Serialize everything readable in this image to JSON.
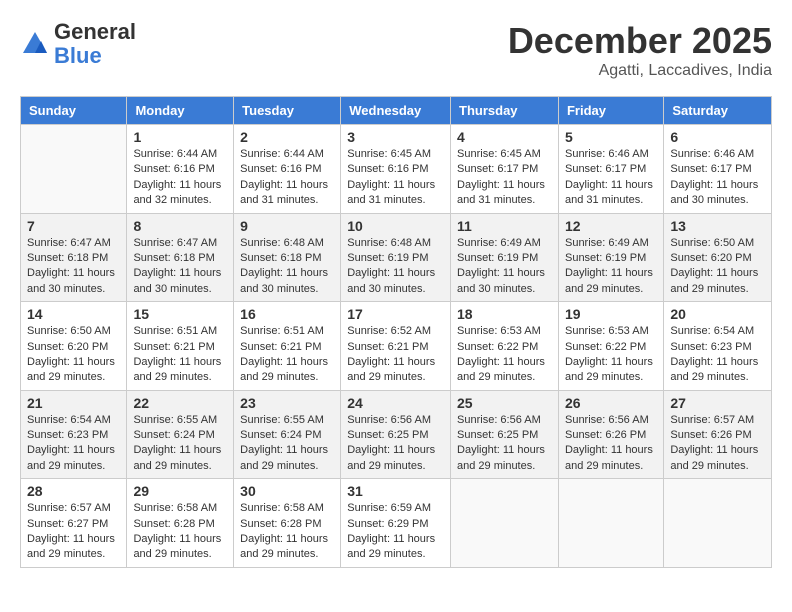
{
  "header": {
    "logo_general": "General",
    "logo_blue": "Blue",
    "title": "December 2025",
    "subtitle": "Agatti, Laccadives, India"
  },
  "calendar": {
    "columns": [
      "Sunday",
      "Monday",
      "Tuesday",
      "Wednesday",
      "Thursday",
      "Friday",
      "Saturday"
    ],
    "weeks": [
      {
        "days": [
          {
            "num": "",
            "info": ""
          },
          {
            "num": "1",
            "info": "Sunrise: 6:44 AM\nSunset: 6:16 PM\nDaylight: 11 hours\nand 32 minutes."
          },
          {
            "num": "2",
            "info": "Sunrise: 6:44 AM\nSunset: 6:16 PM\nDaylight: 11 hours\nand 31 minutes."
          },
          {
            "num": "3",
            "info": "Sunrise: 6:45 AM\nSunset: 6:16 PM\nDaylight: 11 hours\nand 31 minutes."
          },
          {
            "num": "4",
            "info": "Sunrise: 6:45 AM\nSunset: 6:17 PM\nDaylight: 11 hours\nand 31 minutes."
          },
          {
            "num": "5",
            "info": "Sunrise: 6:46 AM\nSunset: 6:17 PM\nDaylight: 11 hours\nand 31 minutes."
          },
          {
            "num": "6",
            "info": "Sunrise: 6:46 AM\nSunset: 6:17 PM\nDaylight: 11 hours\nand 30 minutes."
          }
        ]
      },
      {
        "days": [
          {
            "num": "7",
            "info": "Sunrise: 6:47 AM\nSunset: 6:18 PM\nDaylight: 11 hours\nand 30 minutes."
          },
          {
            "num": "8",
            "info": "Sunrise: 6:47 AM\nSunset: 6:18 PM\nDaylight: 11 hours\nand 30 minutes."
          },
          {
            "num": "9",
            "info": "Sunrise: 6:48 AM\nSunset: 6:18 PM\nDaylight: 11 hours\nand 30 minutes."
          },
          {
            "num": "10",
            "info": "Sunrise: 6:48 AM\nSunset: 6:19 PM\nDaylight: 11 hours\nand 30 minutes."
          },
          {
            "num": "11",
            "info": "Sunrise: 6:49 AM\nSunset: 6:19 PM\nDaylight: 11 hours\nand 30 minutes."
          },
          {
            "num": "12",
            "info": "Sunrise: 6:49 AM\nSunset: 6:19 PM\nDaylight: 11 hours\nand 29 minutes."
          },
          {
            "num": "13",
            "info": "Sunrise: 6:50 AM\nSunset: 6:20 PM\nDaylight: 11 hours\nand 29 minutes."
          }
        ]
      },
      {
        "days": [
          {
            "num": "14",
            "info": "Sunrise: 6:50 AM\nSunset: 6:20 PM\nDaylight: 11 hours\nand 29 minutes."
          },
          {
            "num": "15",
            "info": "Sunrise: 6:51 AM\nSunset: 6:21 PM\nDaylight: 11 hours\nand 29 minutes."
          },
          {
            "num": "16",
            "info": "Sunrise: 6:51 AM\nSunset: 6:21 PM\nDaylight: 11 hours\nand 29 minutes."
          },
          {
            "num": "17",
            "info": "Sunrise: 6:52 AM\nSunset: 6:21 PM\nDaylight: 11 hours\nand 29 minutes."
          },
          {
            "num": "18",
            "info": "Sunrise: 6:53 AM\nSunset: 6:22 PM\nDaylight: 11 hours\nand 29 minutes."
          },
          {
            "num": "19",
            "info": "Sunrise: 6:53 AM\nSunset: 6:22 PM\nDaylight: 11 hours\nand 29 minutes."
          },
          {
            "num": "20",
            "info": "Sunrise: 6:54 AM\nSunset: 6:23 PM\nDaylight: 11 hours\nand 29 minutes."
          }
        ]
      },
      {
        "days": [
          {
            "num": "21",
            "info": "Sunrise: 6:54 AM\nSunset: 6:23 PM\nDaylight: 11 hours\nand 29 minutes."
          },
          {
            "num": "22",
            "info": "Sunrise: 6:55 AM\nSunset: 6:24 PM\nDaylight: 11 hours\nand 29 minutes."
          },
          {
            "num": "23",
            "info": "Sunrise: 6:55 AM\nSunset: 6:24 PM\nDaylight: 11 hours\nand 29 minutes."
          },
          {
            "num": "24",
            "info": "Sunrise: 6:56 AM\nSunset: 6:25 PM\nDaylight: 11 hours\nand 29 minutes."
          },
          {
            "num": "25",
            "info": "Sunrise: 6:56 AM\nSunset: 6:25 PM\nDaylight: 11 hours\nand 29 minutes."
          },
          {
            "num": "26",
            "info": "Sunrise: 6:56 AM\nSunset: 6:26 PM\nDaylight: 11 hours\nand 29 minutes."
          },
          {
            "num": "27",
            "info": "Sunrise: 6:57 AM\nSunset: 6:26 PM\nDaylight: 11 hours\nand 29 minutes."
          }
        ]
      },
      {
        "days": [
          {
            "num": "28",
            "info": "Sunrise: 6:57 AM\nSunset: 6:27 PM\nDaylight: 11 hours\nand 29 minutes."
          },
          {
            "num": "29",
            "info": "Sunrise: 6:58 AM\nSunset: 6:28 PM\nDaylight: 11 hours\nand 29 minutes."
          },
          {
            "num": "30",
            "info": "Sunrise: 6:58 AM\nSunset: 6:28 PM\nDaylight: 11 hours\nand 29 minutes."
          },
          {
            "num": "31",
            "info": "Sunrise: 6:59 AM\nSunset: 6:29 PM\nDaylight: 11 hours\nand 29 minutes."
          },
          {
            "num": "",
            "info": ""
          },
          {
            "num": "",
            "info": ""
          },
          {
            "num": "",
            "info": ""
          }
        ]
      }
    ]
  }
}
